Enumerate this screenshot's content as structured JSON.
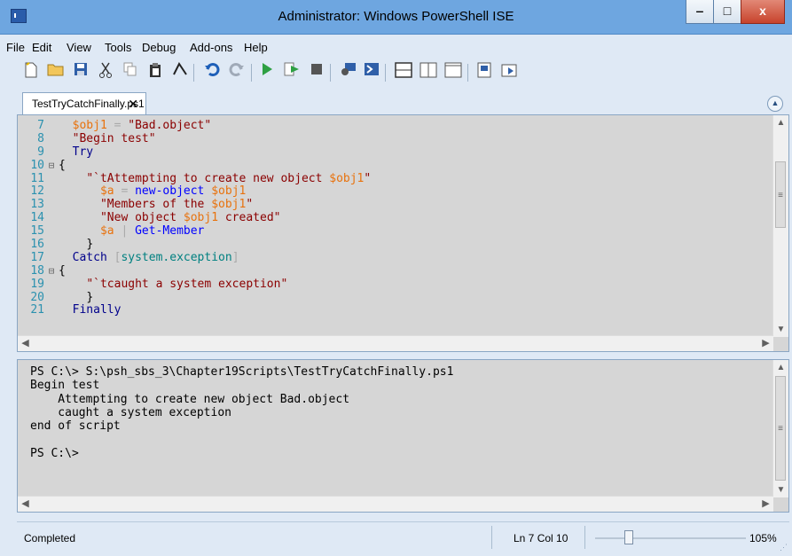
{
  "window": {
    "title": "Administrator: Windows PowerShell ISE",
    "controls": {
      "minimize": "‒",
      "maximize": "□",
      "close": "x"
    }
  },
  "menu": [
    "File",
    "Edit",
    "View",
    "Tools",
    "Debug",
    "Add-ons",
    "Help"
  ],
  "toolbar": {
    "icons": [
      "new-file-icon",
      "open-folder-icon",
      "save-icon",
      "cut-icon",
      "copy-icon",
      "paste-icon",
      "powershell-icon",
      "undo-icon",
      "redo-icon",
      "run-script-icon",
      "run-selection-icon",
      "stop-icon",
      "new-remote-tab-icon",
      "powershell-console-icon",
      "show-script-top-icon",
      "show-script-right-icon",
      "show-script-max-icon",
      "show-commands-icon",
      "show-command-addon-icon"
    ],
    "colors": {
      "run": "#2ea043",
      "undo": "#1e5fb8",
      "stop": "#555555"
    }
  },
  "tabs": [
    {
      "label": "TestTryCatchFinally.ps1",
      "close": "✕"
    }
  ],
  "editor": {
    "lines": [
      {
        "n": "7",
        "fold": "",
        "t": [
          [
            "var",
            "$obj1"
          ],
          [
            "plain",
            " "
          ],
          [
            "op",
            "="
          ],
          [
            "plain",
            " "
          ],
          [
            "str",
            "\"Bad.object\""
          ]
        ],
        "indent": 1
      },
      {
        "n": "8",
        "fold": "",
        "t": [
          [
            "str",
            "\"Begin test\""
          ]
        ],
        "indent": 1
      },
      {
        "n": "9",
        "fold": "",
        "t": [
          [
            "kw",
            "Try"
          ]
        ],
        "indent": 1
      },
      {
        "n": "10",
        "fold": "⊟",
        "t": [
          [
            "plain",
            "{"
          ]
        ],
        "indent": 0
      },
      {
        "n": "11",
        "fold": "",
        "t": [
          [
            "str",
            "\"`tAttempting to create new object "
          ],
          [
            "var",
            "$obj1"
          ],
          [
            "str",
            "\""
          ]
        ],
        "indent": 2
      },
      {
        "n": "12",
        "fold": "",
        "t": [
          [
            "var",
            "$a"
          ],
          [
            "plain",
            " "
          ],
          [
            "op",
            "="
          ],
          [
            "plain",
            " "
          ],
          [
            "cmd",
            "new-object"
          ],
          [
            "plain",
            " "
          ],
          [
            "var",
            "$obj1"
          ]
        ],
        "indent": 3
      },
      {
        "n": "13",
        "fold": "",
        "t": [
          [
            "str",
            "\"Members of the "
          ],
          [
            "var",
            "$obj1"
          ],
          [
            "str",
            "\""
          ]
        ],
        "indent": 3
      },
      {
        "n": "14",
        "fold": "",
        "t": [
          [
            "str",
            "\"New object "
          ],
          [
            "var",
            "$obj1"
          ],
          [
            "str",
            " created\""
          ]
        ],
        "indent": 3
      },
      {
        "n": "15",
        "fold": "",
        "t": [
          [
            "var",
            "$a"
          ],
          [
            "plain",
            " "
          ],
          [
            "op",
            "|"
          ],
          [
            "plain",
            " "
          ],
          [
            "cmd",
            "Get-Member"
          ]
        ],
        "indent": 3
      },
      {
        "n": "16",
        "fold": "",
        "t": [
          [
            "plain",
            "}"
          ]
        ],
        "indent": 2
      },
      {
        "n": "17",
        "fold": "",
        "t": [
          [
            "kw",
            "Catch"
          ],
          [
            "plain",
            " "
          ],
          [
            "op",
            "["
          ],
          [
            "typ",
            "system.exception"
          ],
          [
            "op",
            "]"
          ]
        ],
        "indent": 1
      },
      {
        "n": "18",
        "fold": "⊟",
        "t": [
          [
            "plain",
            "{"
          ]
        ],
        "indent": 0
      },
      {
        "n": "19",
        "fold": "",
        "t": [
          [
            "str",
            "\"`tcaught a system exception\""
          ]
        ],
        "indent": 2
      },
      {
        "n": "20",
        "fold": "",
        "t": [
          [
            "plain",
            "}"
          ]
        ],
        "indent": 2
      },
      {
        "n": "21",
        "fold": "",
        "t": [
          [
            "kw",
            "Finally"
          ]
        ],
        "indent": 1
      }
    ]
  },
  "console": {
    "lines": [
      "PS C:\\> S:\\psh_sbs_3\\Chapter19Scripts\\TestTryCatchFinally.ps1",
      "Begin test",
      "    Attempting to create new object Bad.object",
      "    caught a system exception",
      "end of script",
      "",
      "PS C:\\>"
    ]
  },
  "status": {
    "text": "Completed",
    "position": "Ln 7  Col 10",
    "zoom": "105%",
    "zoom_level": 105
  }
}
